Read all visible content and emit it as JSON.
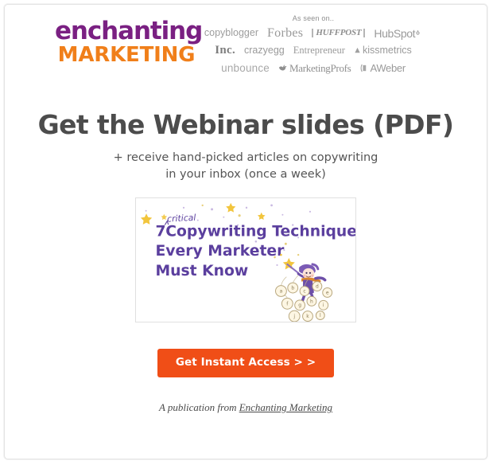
{
  "brand": {
    "logo_top": "enchanting",
    "logo_bottom": "MARKETING",
    "logo_purple": "#7a2082",
    "logo_orange": "#f07f1a"
  },
  "as_seen_on": {
    "label": "As seen on..",
    "rows": [
      [
        {
          "name": "copyblogger",
          "label": "copyblogger",
          "icon": ""
        },
        {
          "name": "forbes",
          "label": "Forbes",
          "icon": ""
        },
        {
          "name": "huffpost",
          "label": "HUFFPOST",
          "icon": ""
        },
        {
          "name": "hubspot",
          "label": "HubSpot",
          "icon": "sprocket-icon"
        }
      ],
      [
        {
          "name": "inc",
          "label": "Inc.",
          "icon": ""
        },
        {
          "name": "crazyegg",
          "label": "crazyegg",
          "icon": ""
        },
        {
          "name": "entrepreneur",
          "label": "Entrepreneur",
          "icon": ""
        },
        {
          "name": "kissmetrics",
          "label": "kissmetrics",
          "icon": "droplet-icon"
        }
      ],
      [
        {
          "name": "unbounce",
          "label": "unbounce",
          "icon": ""
        },
        {
          "name": "marketingprofs",
          "label": "MarketingProfs",
          "icon": "bird-icon"
        },
        {
          "name": "aweber",
          "label": "AWeber",
          "icon": "bracket-icon"
        }
      ]
    ]
  },
  "main": {
    "headline": "Get the Webinar slides (PDF)",
    "subheadline_line1": "+ receive hand-picked articles on copywriting",
    "subheadline_line2": "in your inbox (once a week)",
    "headline_color": "#4c4c4c"
  },
  "slide_preview": {
    "annotation": "critical",
    "number": "7",
    "line1": "Copywriting Techniques",
    "line2": "Every Marketer",
    "line3": "Must Know",
    "text_color": "#5b3f9e",
    "star_color": "#f2c53d",
    "illustration": "magician-with-wand-illustration"
  },
  "cta": {
    "label": "Get Instant Access > >",
    "background": "#f04e17",
    "text_color": "#ffffff"
  },
  "footer": {
    "prefix": "A publication from ",
    "link_label": "Enchanting Marketing"
  }
}
